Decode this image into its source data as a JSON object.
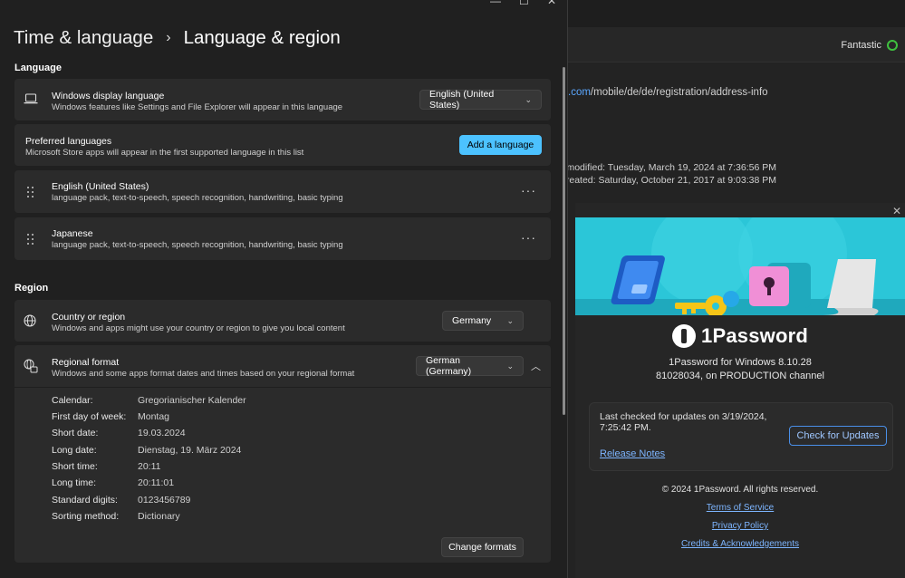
{
  "background_window": {
    "vault_status": "Fantastic",
    "url_host": ".com",
    "url_path": "/mobile/de/de/registration/address-info",
    "modified": "modified: Tuesday, March 19, 2024 at 7:36:56 PM",
    "created": "created: Saturday, October 21, 2017 at 9:03:38 PM"
  },
  "about": {
    "close_glyph": "✕",
    "app_name": "1Password",
    "version": "1Password for Windows 8.10.28",
    "build": "81028034, on PRODUCTION channel",
    "last_checked": "Last checked for updates on 3/19/2024, 7:25:42 PM.",
    "check_button": "Check for Updates",
    "release_notes": "Release Notes",
    "copyright": "© 2024 1Password. All rights reserved.",
    "terms": "Terms of Service",
    "privacy": "Privacy Policy",
    "credits": "Credits & Acknowledgements",
    "accent": "#2bc6d8"
  },
  "settings": {
    "breadcrumb_parent": "Time & language",
    "breadcrumb_current": "Language & region",
    "language_section": "Language",
    "display_language": {
      "title": "Windows display language",
      "subtitle": "Windows features like Settings and File Explorer will appear in this language",
      "value": "English (United States)"
    },
    "preferred": {
      "title": "Preferred languages",
      "subtitle": "Microsoft Store apps will appear in the first supported language in this list",
      "button": "Add a language"
    },
    "languages": [
      {
        "name": "English (United States)",
        "features": "language pack, text-to-speech, speech recognition, handwriting, basic typing"
      },
      {
        "name": "Japanese",
        "features": "language pack, text-to-speech, speech recognition, handwriting, basic typing"
      }
    ],
    "more_glyph": "···",
    "region_section": "Region",
    "country": {
      "title": "Country or region",
      "subtitle": "Windows and apps might use your country or region to give you local content",
      "value": "Germany"
    },
    "regional_format": {
      "title": "Regional format",
      "subtitle": "Windows and some apps format dates and times based on your regional format",
      "value": "German (Germany)"
    },
    "formats": [
      {
        "key": "Calendar:",
        "value": "Gregorianischer Kalender"
      },
      {
        "key": "First day of week:",
        "value": "Montag"
      },
      {
        "key": "Short date:",
        "value": "19.03.2024"
      },
      {
        "key": "Long date:",
        "value": "Dienstag, 19. März 2024"
      },
      {
        "key": "Short time:",
        "value": "20:11"
      },
      {
        "key": "Long time:",
        "value": "20:11:01"
      },
      {
        "key": "Standard digits:",
        "value": "0123456789"
      },
      {
        "key": "Sorting method:",
        "value": "Dictionary"
      }
    ],
    "change_formats": "Change formats",
    "accent": "#4cc2ff"
  }
}
